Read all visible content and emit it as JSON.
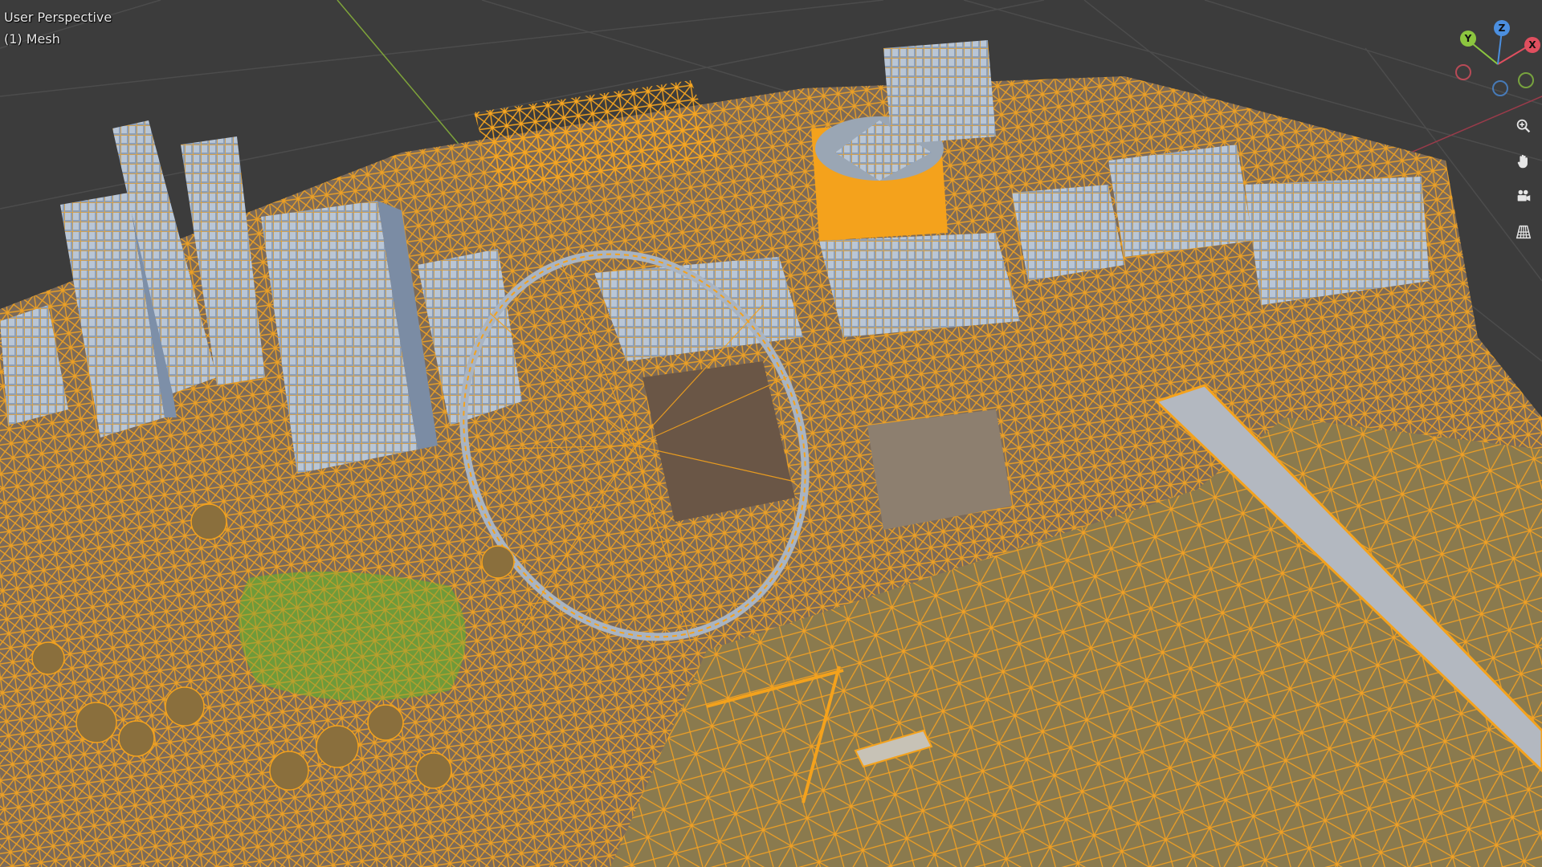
{
  "viewport": {
    "view_name": "User Perspective",
    "object_name": "(1) Mesh",
    "mode": "Wireframe overlay on textured mesh",
    "wire_color": "#f4a21c",
    "grid_color": "#4a4a4a",
    "background_color": "#3c3c3c"
  },
  "gizmo": {
    "x_label": "X",
    "y_label": "Y",
    "z_label": "Z",
    "x_color": "#e04f5f",
    "y_color": "#8cc63f",
    "z_color": "#4b8fe0"
  },
  "tools": [
    {
      "name": "zoom-icon"
    },
    {
      "name": "hand-pan-icon"
    },
    {
      "name": "camera-icon"
    },
    {
      "name": "ortho-grid-icon"
    }
  ]
}
